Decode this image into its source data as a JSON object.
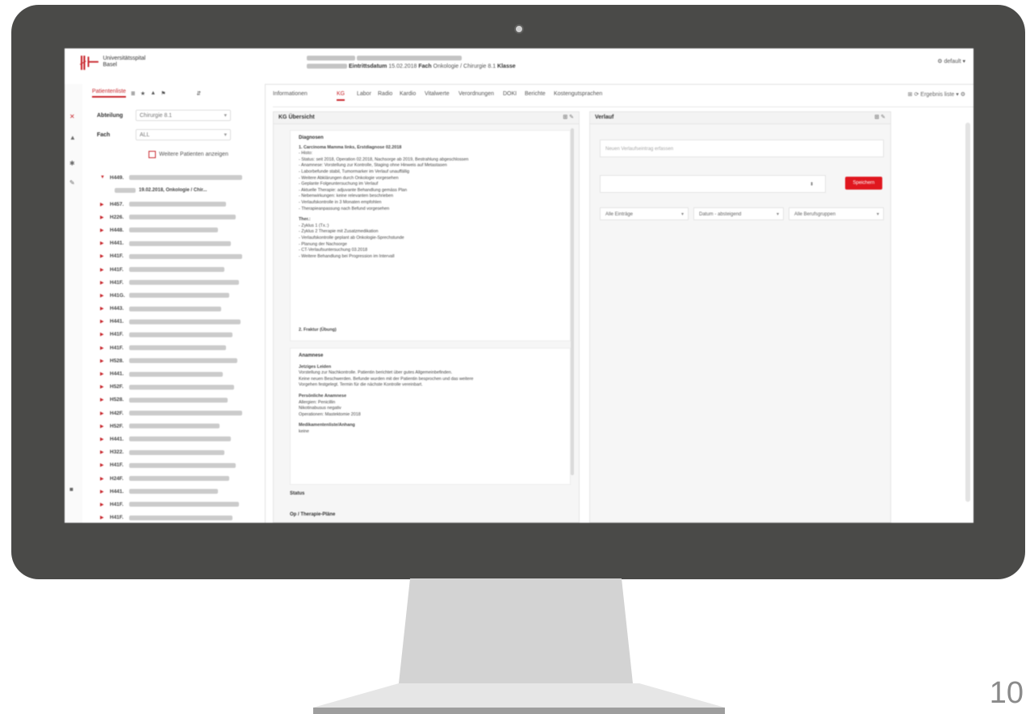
{
  "slide": {
    "page_number": "10"
  },
  "app": {
    "logo_mark": "∦⊢",
    "logo_line1": "Universitätsspital",
    "logo_line2": "Basel",
    "patient_line2_label1": "Eintrittsdatum",
    "patient_line2_val1": "15.02.2018",
    "patient_line2_label2": "Fach",
    "patient_line2_val2": "Onkologie / Chirurgie 8.1",
    "patient_line2_label3": "Klasse",
    "user_menu": "⚙ default ▾"
  },
  "sidebar": {
    "tab_active": "Patientenliste",
    "tool_icons": [
      "≣",
      "★",
      "▲",
      "⚑",
      "⇵"
    ],
    "filter_station_label": "Abteilung",
    "filter_station_value": "Chirurgie 8.1",
    "filter_fach_label": "Fach",
    "filter_fach_value": "ALL",
    "checkbox_label": "Weitere Patienten anzeigen",
    "first_row_id": "H449.",
    "first_row_sub": "19.02.2018, Onkologie / Chir..."
  },
  "patients": [
    {
      "id": "H457."
    },
    {
      "id": "H226."
    },
    {
      "id": "H448."
    },
    {
      "id": "H441."
    },
    {
      "id": "H41F."
    },
    {
      "id": "H41F."
    },
    {
      "id": "H41F."
    },
    {
      "id": "H41G."
    },
    {
      "id": "H443."
    },
    {
      "id": "H441."
    },
    {
      "id": "H41F."
    },
    {
      "id": "H41F."
    },
    {
      "id": "H528."
    },
    {
      "id": "H441."
    },
    {
      "id": "H52F."
    },
    {
      "id": "H528."
    },
    {
      "id": "H42F."
    },
    {
      "id": "H52F."
    },
    {
      "id": "H441."
    },
    {
      "id": "H322."
    },
    {
      "id": "H41F."
    },
    {
      "id": "H24F."
    },
    {
      "id": "H441."
    },
    {
      "id": "H41F."
    },
    {
      "id": "H41F."
    }
  ],
  "main_tabs": [
    "Informationen",
    "KG",
    "Labor",
    "Radio",
    "Kardio",
    "Vitalwerte",
    "Verordnungen",
    "DOKI",
    "Berichte",
    "Kostengutsprachen"
  ],
  "main_tools": "⊞  ⟳ Ergebnis liste ▾   ⚙",
  "left_panel": {
    "title": "KG Übersicht",
    "tools": "⊞ ✎",
    "diag_heading": "Diagnosen",
    "diag_title": "1. Carcinoma Mamma links, Erstdiagnose 02.2018",
    "diag_lines": [
      "- Histo:",
      "- Status: seit 2018, Operation 02.2018, Nachsorge ab 2019, Bestrahlung abgeschlossen",
      "- Anamnese: Vorstellung zur Kontrolle, Staging ohne Hinweis auf Metastasen",
      "- Laborbefunde stabil, Tumormarker im Verlauf unauffällig",
      "- Weitere Abklärungen durch Onkologie vorgesehen",
      "- Geplante Folgeuntersuchung im Verlauf",
      "- Aktuelle Therapie: adjuvante Behandlung gemäss Plan",
      "- Nebenwirkungen: keine relevanten beschrieben",
      "- Verlaufskontrolle in 3 Monaten empfohlen",
      "- Therapieanpassung nach Befund vorgesehen"
    ],
    "ther_label": "Ther.:",
    "ther_lines": [
      "- Zyklus 1 (Tx.:)",
      "- Zyklus 2 Therapie mit Zusatzmedikation",
      "- Verlaufskontrolle geplant ab Onkologie-Sprechstunde",
      "- Planung der Nachsorge",
      "- CT-Verlaufsuntersuchung 03.2018",
      "- Weitere Behandlung bei Progression im Intervall"
    ],
    "diag2": "2. Fraktur (Übung)",
    "sect2_heading": "Anamnese",
    "sect2_sub": "Jetziges Leiden",
    "sect2_lines": [
      "Vorstellung zur Nachkontrolle. Patientin berichtet über gutes Allgemeinbefinden.",
      "Keine neuen Beschwerden. Befunde wurden mit der Patientin besprochen und das weitere",
      "Vorgehen festgelegt. Termin für die nächste Kontrolle vereinbart."
    ],
    "sect2_lbl2": "Persönliche Anamnese",
    "sect2_lines2": [
      "Allergien: Penicillin",
      "Nikotinabusus negativ",
      "Operationen: Mastektomie 2018"
    ],
    "sect2_lbl3": "Medikamentenliste/Anhang",
    "sect2_val3": "keine",
    "sect3_heading": "Status",
    "sect4_heading": "Op / Therapie-Pläne"
  },
  "right_panel": {
    "title": "Verlauf",
    "tools": "⊞ ✎",
    "note_placeholder": "Neuen Verlaufseintrag erfassen",
    "entry_value": "",
    "entry_icon": "⬍",
    "save_label": "Speichern",
    "select1": "Alle Einträge",
    "select2": "Datum - absteigend",
    "select3": "Alle Berufsgruppen"
  }
}
